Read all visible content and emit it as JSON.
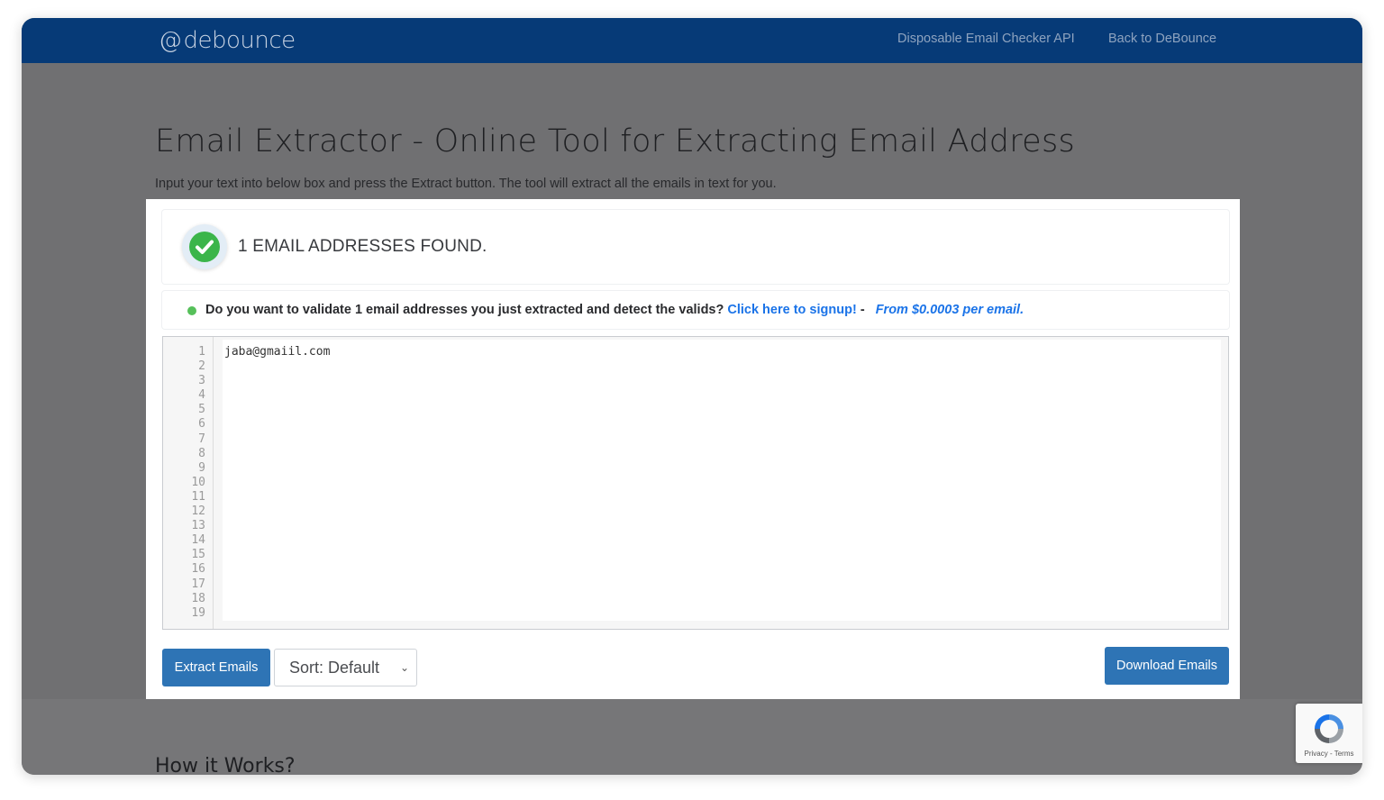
{
  "navbar": {
    "brand": "debounce",
    "links": [
      "Disposable Email Checker API",
      "Back to DeBounce"
    ]
  },
  "page": {
    "title": "Email Extractor - Online Tool for Extracting Email Address",
    "subtitle": "Input your text into below box and press the Extract button. The tool will extract all the emails in text for you.",
    "how_title": "How it Works?"
  },
  "result": {
    "status_text": "1 EMAIL ADDRESSES FOUND."
  },
  "promo": {
    "text": "Do you want to validate 1 email addresses you just extracted and detect the valids?",
    "link": "Click here to signup!",
    "separator": " -",
    "price": "From $0.0003 per email."
  },
  "editor": {
    "line_numbers": [
      "1",
      "2",
      "3",
      "4",
      "5",
      "6",
      "7",
      "8",
      "9",
      "10",
      "11",
      "12",
      "13",
      "14",
      "15",
      "16",
      "17",
      "18",
      "19"
    ],
    "content": "jaba@gmaiil.com"
  },
  "controls": {
    "extract_label": "Extract Emails",
    "sort_label": "Sort: Default",
    "download_label": "Download Emails"
  },
  "recaptcha": {
    "text": "Privacy - Terms"
  },
  "colors": {
    "navbar": "#063a77",
    "primary_button": "#2e74b5",
    "link": "#1a73e8",
    "success": "#3bb54a",
    "overlay": "#707072"
  },
  "icons": [
    "check-icon",
    "status-dot-icon",
    "chevron-down-icon",
    "recaptcha-icon"
  ]
}
